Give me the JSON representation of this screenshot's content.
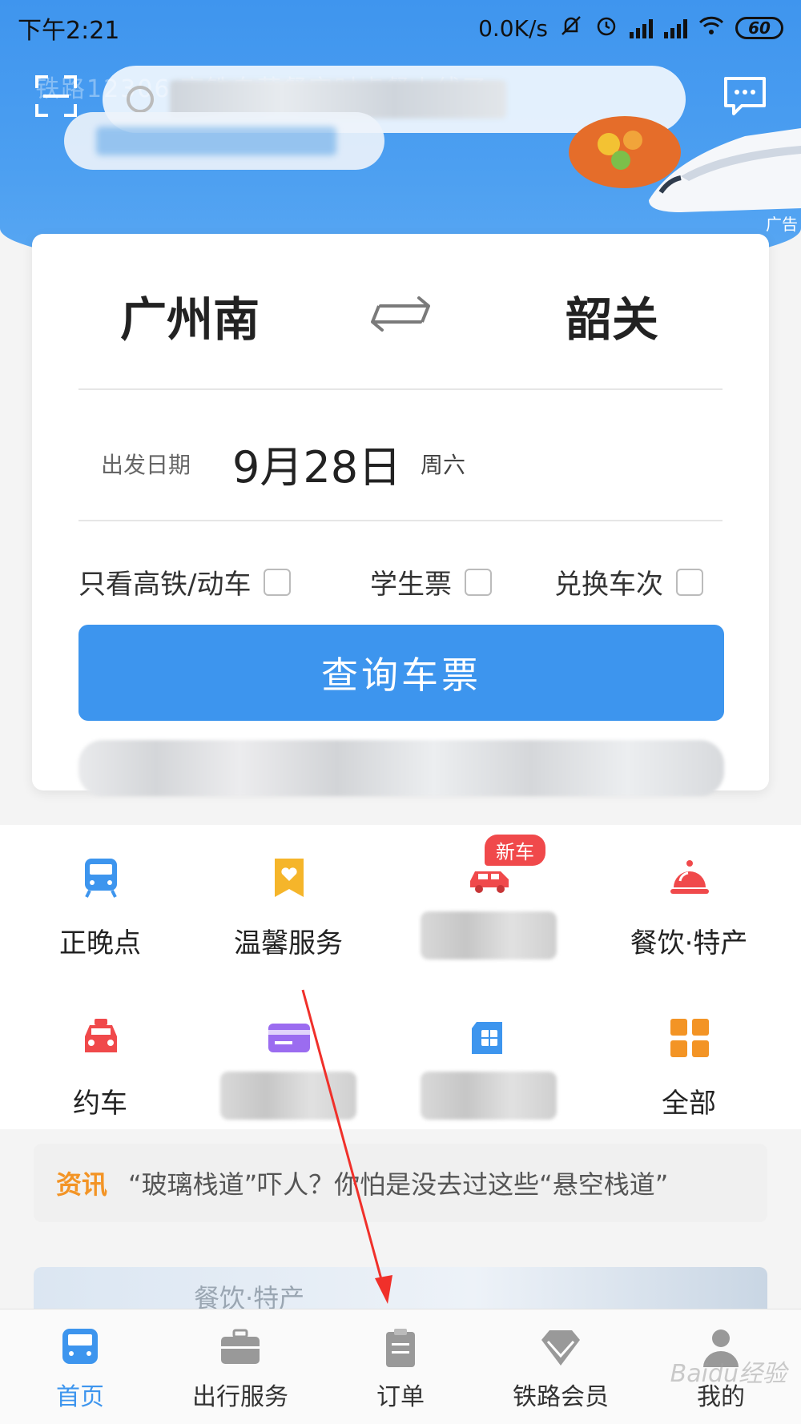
{
  "status_bar": {
    "time": "下午2:21",
    "net_speed": "0.0K/s",
    "battery": "60"
  },
  "header": {
    "banner_text": "铁路12306 高铁自营餐实时点餐上线了",
    "ad_label": "广告",
    "icons": {
      "scan": "scan-icon",
      "message": "message-icon"
    }
  },
  "booking": {
    "from_station": "广州南",
    "to_station": "韶关",
    "date_label": "出发日期",
    "date_value": "9月28日",
    "weekday": "周六",
    "options": [
      {
        "label": "只看高铁/动车",
        "checked": false
      },
      {
        "label": "学生票",
        "checked": false
      },
      {
        "label": "兑换车次",
        "checked": false
      }
    ],
    "query_button": "查询车票"
  },
  "services": {
    "row1": [
      {
        "label": "正晚点",
        "icon": "train-front-icon",
        "color": "#3d95ee"
      },
      {
        "label": "温馨服务",
        "icon": "bookmark-heart-icon",
        "color": "#f5b52a"
      },
      {
        "label": "",
        "icon": "car-icon",
        "color": "#f0494b",
        "badge": "新车"
      },
      {
        "label": "餐饮·特产",
        "icon": "food-cloche-icon",
        "color": "#f0494b"
      }
    ],
    "row2": [
      {
        "label": "约车",
        "icon": "taxi-icon",
        "color": "#f0494b"
      },
      {
        "label": "",
        "icon": "card-icon",
        "color": "#9b6cf0"
      },
      {
        "label": "",
        "icon": "sim-card-icon",
        "color": "#3d95ee"
      },
      {
        "label": "全部",
        "icon": "grid-icon",
        "color": "#f39425"
      }
    ]
  },
  "news": {
    "tag": "资讯",
    "headline": "“玻璃栈道”吓人？你怕是没去过这些“悬空栈道”"
  },
  "promo": {
    "title": "餐饮·特产"
  },
  "tabbar": {
    "items": [
      {
        "label": "首页",
        "icon": "train-home-icon",
        "active": true
      },
      {
        "label": "出行服务",
        "icon": "briefcase-icon",
        "active": false
      },
      {
        "label": "订单",
        "icon": "clipboard-icon",
        "active": false
      },
      {
        "label": "铁路会员",
        "icon": "diamond-icon",
        "active": false
      },
      {
        "label": "我的",
        "icon": "person-icon",
        "active": false
      }
    ]
  },
  "colors": {
    "accent": "#3d95ee",
    "news_tag": "#f39425",
    "badge": "#f0494b"
  },
  "watermark": "Baidu经验"
}
